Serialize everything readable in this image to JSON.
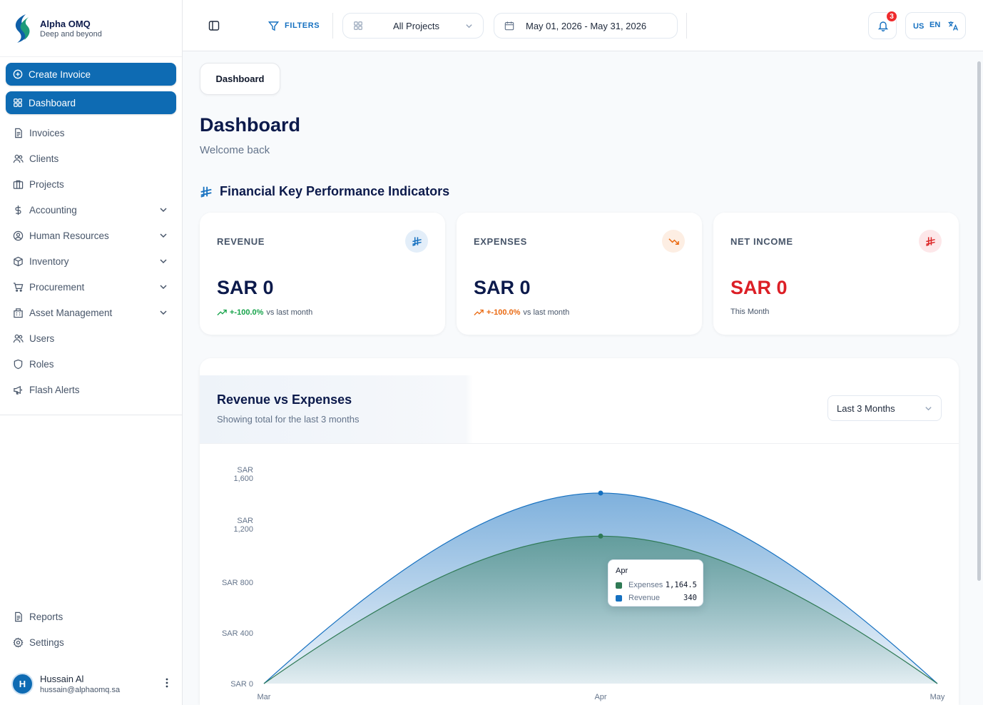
{
  "brand": {
    "name": "Alpha OMQ",
    "tagline": "Deep and beyond"
  },
  "sidebar": {
    "create_label": "Create Invoice",
    "items": [
      {
        "label": "Dashboard",
        "icon": "grid-icon",
        "active": true
      },
      {
        "label": "Invoices",
        "icon": "document-icon"
      },
      {
        "label": "Clients",
        "icon": "users-icon"
      },
      {
        "label": "Projects",
        "icon": "columns-icon"
      },
      {
        "label": "Accounting",
        "icon": "dollar-icon",
        "expandable": true
      },
      {
        "label": "Human Resources",
        "icon": "user-circle-icon",
        "expandable": true
      },
      {
        "label": "Inventory",
        "icon": "package-icon",
        "expandable": true
      },
      {
        "label": "Procurement",
        "icon": "cart-icon",
        "expandable": true
      },
      {
        "label": "Asset Management",
        "icon": "building-icon",
        "expandable": true
      },
      {
        "label": "Users",
        "icon": "users-icon"
      },
      {
        "label": "Roles",
        "icon": "shield-icon"
      },
      {
        "label": "Flash Alerts",
        "icon": "megaphone-icon"
      }
    ],
    "bottom": [
      {
        "label": "Reports",
        "icon": "report-icon"
      },
      {
        "label": "Settings",
        "icon": "gear-icon"
      }
    ],
    "user": {
      "initial": "H",
      "name": "Hussain Al",
      "email": "hussain@alphaomq.sa"
    }
  },
  "header": {
    "filters_label": "FILTERS",
    "project_select": "All Projects",
    "date_range": "May 01, 2026 - May 31, 2026",
    "notifications_count": "3",
    "lang_country": "US",
    "lang_code": "EN"
  },
  "main": {
    "breadcrumb": "Dashboard",
    "title": "Dashboard",
    "subtitle": "Welcome back",
    "kpi_section_title": "Financial Key Performance Indicators",
    "kpis": [
      {
        "label": "REVENUE",
        "value": "SAR 0",
        "trend_pct": "+-100.0%",
        "trend_text": "vs last month",
        "accent": "#1570c0",
        "icon_bg": "#e3eef9",
        "value_color": "#0c1a4b",
        "trend_color": "#16a34a"
      },
      {
        "label": "EXPENSES",
        "value": "SAR 0",
        "trend_pct": "+-100.0%",
        "trend_text": "vs last month",
        "accent": "#ea6a12",
        "icon_bg": "#fdeee3",
        "value_color": "#0c1a4b",
        "trend_color": "#ea6a12"
      },
      {
        "label": "NET INCOME",
        "value": "SAR 0",
        "trend_text": "This Month",
        "accent": "#dc2626",
        "icon_bg": "#fde7e9",
        "value_color": "#dc1f26"
      }
    ]
  },
  "chart": {
    "title": "Revenue vs Expenses",
    "subtitle": "Showing total for the last 3 months",
    "range_select": "Last 3 Months",
    "tooltip": {
      "title": "Apr",
      "rows": [
        {
          "name": "Expenses",
          "value": "1,164.5",
          "color": "#2f7a55"
        },
        {
          "name": "Revenue",
          "value": "340",
          "color": "#1570c0"
        }
      ]
    }
  },
  "chart_data": {
    "type": "area",
    "categories": [
      "Mar",
      "Apr",
      "May"
    ],
    "series": [
      {
        "name": "Expenses",
        "values": [
          0,
          1164.5,
          0
        ],
        "color": "#2f7a55"
      },
      {
        "name": "Revenue",
        "values": [
          0,
          340,
          0
        ],
        "color": "#1570c0"
      }
    ],
    "stacked": true,
    "ylim": [
      0,
      1600
    ],
    "yticks": [
      0,
      400,
      800,
      1200,
      1600
    ],
    "ytick_labels": [
      "SAR 0",
      "SAR 400",
      "SAR 800",
      "SAR 1,200",
      "SAR 1,600"
    ],
    "grid": false
  }
}
